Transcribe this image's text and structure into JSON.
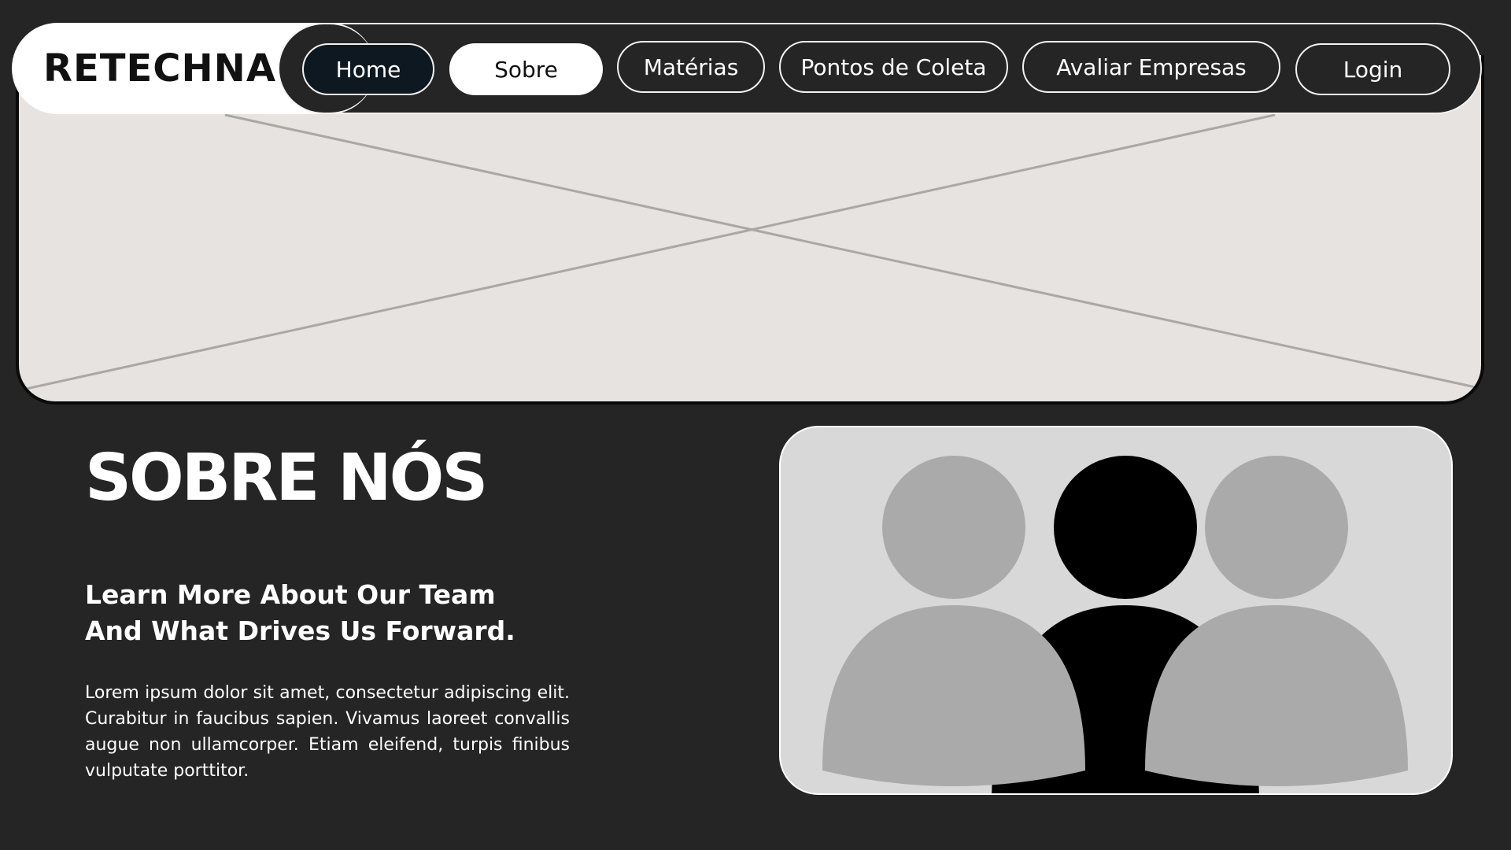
{
  "brand": {
    "name": "RETECHNA"
  },
  "nav": {
    "items": [
      {
        "label": "Home"
      },
      {
        "label": "Sobre"
      },
      {
        "label": "Matérias"
      },
      {
        "label": "Pontos de Coleta"
      },
      {
        "label": "Avaliar Empresas"
      },
      {
        "label": "Login"
      }
    ],
    "active": "Sobre"
  },
  "hero": {
    "icon": "image-placeholder-icon"
  },
  "about": {
    "title": "SOBRE NÓS",
    "subtitle_line1": "Learn More About Our Team",
    "subtitle_line2": "And What Drives Us Forward.",
    "body": "Lorem ipsum dolor sit amet, consectetur adipiscing elit. Curabitur in faucibus sapien. Vivamus laoreet convallis augue non ullamcorper. Etiam eleifend, turpis finibus vulputate porttitor."
  },
  "team_image": {
    "icon": "team-group-icon"
  },
  "colors": {
    "background": "#252525",
    "hero_fill": "#e6e3e0",
    "accent_dark": "#0e1820",
    "person_gray": "#aaaaaa",
    "person_black": "#000000"
  }
}
